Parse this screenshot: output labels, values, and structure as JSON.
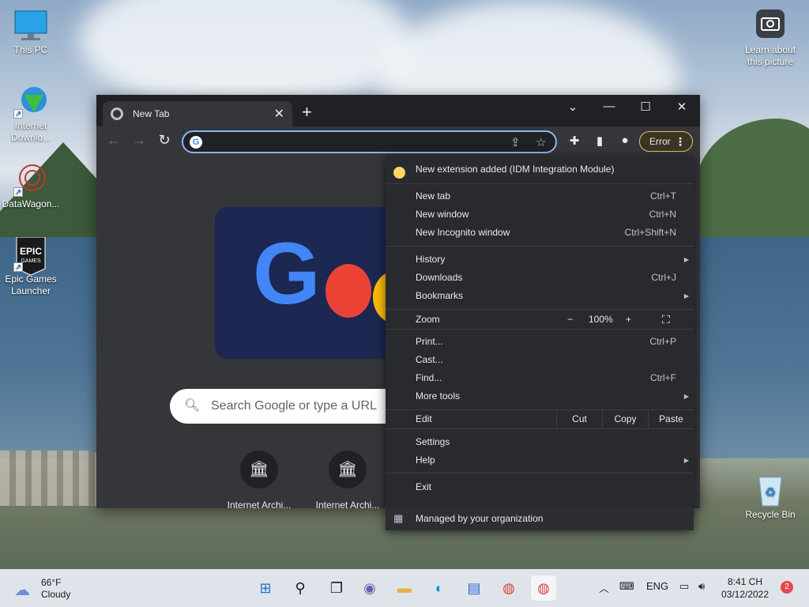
{
  "desktop": {
    "icons": [
      {
        "label": "This PC",
        "icon": "computer-icon"
      },
      {
        "label": "Internet Downlo...",
        "icon": "idm-icon"
      },
      {
        "label": "DataWagon...",
        "icon": "datawagon-icon"
      },
      {
        "label": "Epic Games Launcher",
        "icon": "epic-games-icon",
        "logo_text": "EPIC GAMES"
      },
      {
        "label": "Learn about this picture",
        "icon": "camera-icon"
      },
      {
        "label": "Recycle Bin",
        "icon": "recycle-bin-icon"
      }
    ]
  },
  "browser": {
    "tab_title": "New Tab",
    "omnibox_value": "",
    "error_label": "Error",
    "search_placeholder": "Search Google or type a URL",
    "shortcuts": [
      {
        "label": "Internet Archi..."
      },
      {
        "label": "Internet Archi..."
      }
    ],
    "accent_color": "#8ab4f8"
  },
  "menu": {
    "notice": "New extension added (IDM Integration Module)",
    "items_group1": [
      {
        "label": "New tab",
        "shortcut": "Ctrl+T"
      },
      {
        "label": "New window",
        "shortcut": "Ctrl+N"
      },
      {
        "label": "New Incognito window",
        "shortcut": "Ctrl+Shift+N"
      }
    ],
    "items_group2": [
      {
        "label": "History",
        "shortcut": ""
      },
      {
        "label": "Downloads",
        "shortcut": "Ctrl+J"
      },
      {
        "label": "Bookmarks",
        "shortcut": ""
      }
    ],
    "zoom": {
      "label": "Zoom",
      "minus": "−",
      "value": "100%",
      "plus": "+"
    },
    "items_group3": [
      {
        "label": "Print...",
        "shortcut": "Ctrl+P"
      },
      {
        "label": "Cast...",
        "shortcut": ""
      },
      {
        "label": "Find...",
        "shortcut": "Ctrl+F"
      },
      {
        "label": "More tools",
        "shortcut": ""
      }
    ],
    "edit": {
      "label": "Edit",
      "cut": "Cut",
      "copy": "Copy",
      "paste": "Paste"
    },
    "items_group4": [
      {
        "label": "Settings"
      },
      {
        "label": "Help"
      }
    ],
    "exit": "Exit",
    "managed": "Managed by your organization"
  },
  "taskbar": {
    "weather_temp": "66°F",
    "weather_desc": "Cloudy",
    "language": "ENG",
    "time": "8:41 CH",
    "date": "03/12/2022",
    "notifications": "2"
  }
}
